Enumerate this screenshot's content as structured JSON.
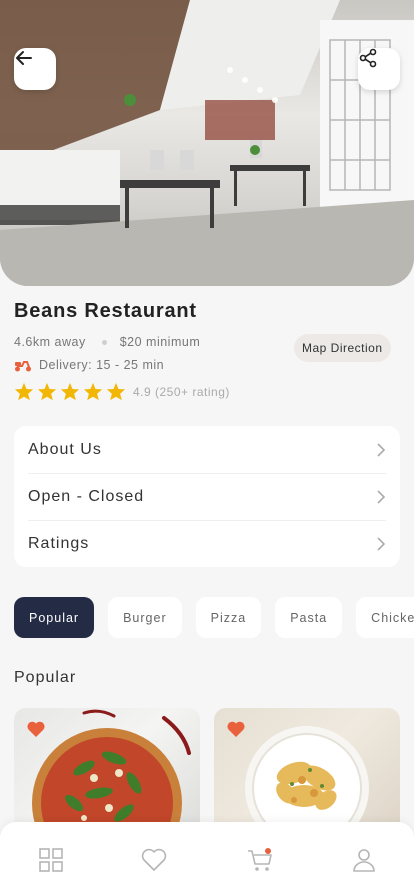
{
  "restaurant": {
    "name": "Beans Restaurant",
    "distance": "4.6km away",
    "minimum": "$20 minimum",
    "delivery": "Delivery: 15 - 25 min",
    "rating_text": "4.9 (250+ rating)",
    "stars": 5
  },
  "actions": {
    "map_direction": "Map Direction"
  },
  "menu": {
    "items": [
      {
        "label": "About Us"
      },
      {
        "label": "Open - Closed"
      },
      {
        "label": "Ratings"
      }
    ]
  },
  "categories": {
    "items": [
      "Popular",
      "Burger",
      "Pizza",
      "Pasta",
      "Chicken"
    ],
    "selected": "Popular"
  },
  "section": {
    "title": "Popular"
  },
  "icons": {
    "back": "arrow-left-icon",
    "share": "share-icon",
    "scooter": "scooter-icon",
    "star": "star-icon",
    "chevron": "chevron-right-icon",
    "heart": "heart-icon",
    "nav": [
      "grid-icon",
      "heart-icon",
      "cart-icon",
      "user-icon"
    ]
  },
  "colors": {
    "accent_dark": "#232b45",
    "star": "#f2b705",
    "heart": "#e8613c",
    "scooter": "#e8613c",
    "cart_badge": "#e8613c"
  }
}
